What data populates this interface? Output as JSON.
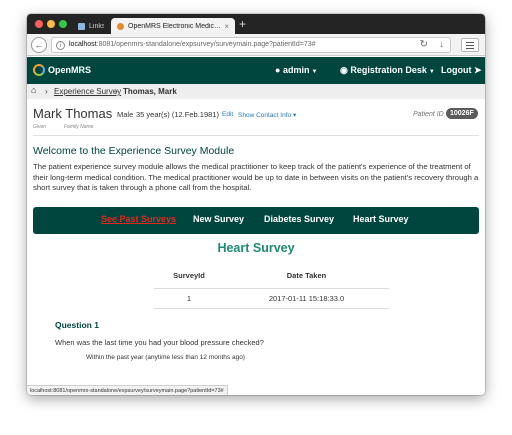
{
  "browser": {
    "tabs": [
      {
        "label": "Links",
        "active": false,
        "icon": "folder-icon"
      },
      {
        "label": "OpenMRS Electronic Medic…",
        "active": true,
        "icon": "openmrs-favicon"
      }
    ],
    "new_tab_label": "+",
    "url_host": "localhost",
    "url_path": ":8081/openmrs-standalone/expsurvey/surveymain.page?patientId=73#",
    "status_url": "localhost:8081/openmrs-standalone/expsurvey/surveymain.page?patientId=73#"
  },
  "header": {
    "brand": "OpenMRS",
    "user": "admin",
    "location": "Registration Desk",
    "logout": "Logout",
    "colors": {
      "bar": "#00463f"
    }
  },
  "breadcrumb": {
    "link": "Experience Survey",
    "current": "Thomas, Mark"
  },
  "patient": {
    "name": "Mark Thomas",
    "gender": "Male",
    "age": "35 year(s) (12.Feb.1981)",
    "edit": "Edit",
    "show_contact": "Show Contact Info",
    "given_caption": "Given",
    "family_caption": "Family Name",
    "id_label": "Patient ID",
    "id": "10026F"
  },
  "main": {
    "title": "Welcome to the Experience Survey Module",
    "description": "The patient experience survey module allows the medical practitioner to keep track of the patient's experience of the treatment of their long-term medical condition. The medical practitioner would be up to date in between visits on the patient's recovery through a short survey that is taken through a phone call from the hospital.",
    "nav": {
      "past": "See Past Surveys",
      "new": "New Survey",
      "diabetes": "Diabetes Survey",
      "heart": "Heart Survey"
    },
    "survey_title": "Heart Survey",
    "table": {
      "headers": [
        "SurveyId",
        "Date Taken"
      ],
      "rows": [
        [
          "1",
          "2017-01-11 15:18:33.0"
        ]
      ]
    },
    "question": {
      "title": "Question 1",
      "text": "When was the last time you had your blood pressure checked?",
      "answer": "Within the past year (anytime less than 12 months ago)"
    },
    "colors": {
      "accent": "#1e8a73",
      "active_link": "#e5261f"
    }
  }
}
